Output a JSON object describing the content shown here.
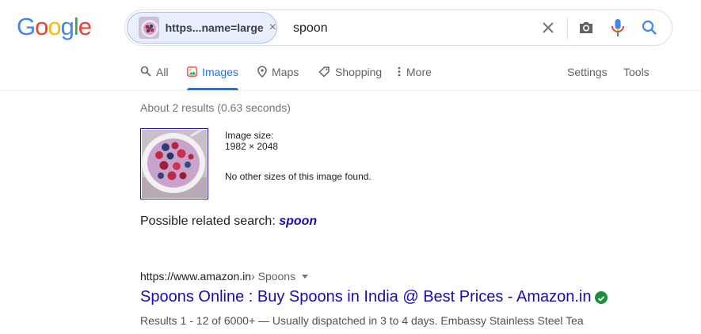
{
  "logo": {
    "text": "Google",
    "letters": [
      {
        "ch": "G",
        "color": "#4285f4"
      },
      {
        "ch": "o",
        "color": "#ea4335"
      },
      {
        "ch": "o",
        "color": "#fbbc05"
      },
      {
        "ch": "g",
        "color": "#4285f4"
      },
      {
        "ch": "l",
        "color": "#34a853"
      },
      {
        "ch": "e",
        "color": "#ea4335"
      }
    ]
  },
  "search": {
    "image_chip_label": "https...name=large",
    "chip_close": "×",
    "query": "spoon",
    "icons": [
      "close-icon",
      "camera-icon",
      "mic-icon",
      "search-icon"
    ]
  },
  "tabs": {
    "all": "All",
    "images": "Images",
    "maps": "Maps",
    "shopping": "Shopping",
    "more": "More",
    "settings": "Settings",
    "tools": "Tools",
    "active": "images"
  },
  "results": {
    "stats": "About 2 results (0.63 seconds)",
    "image_size_label": "Image size:",
    "image_size_value": "1982 × 2048",
    "other_sizes": "No other sizes of this image found.",
    "related_prefix": "Possible related search: ",
    "related_query": "spoon",
    "first": {
      "url": "https://www.amazon.in",
      "breadcrumb": " › Spoons",
      "title": "Spoons Online : Buy Spoons in India @ Best Prices - Amazon.in",
      "snippet": "Results 1 - 12 of 6000+ — Usually dispatched in 3 to 4 days. Embassy Stainless Steel Tea"
    }
  },
  "colors": {
    "accent": "#1a73e8",
    "link": "#1a0dab",
    "verified": "#1e8e3e"
  }
}
